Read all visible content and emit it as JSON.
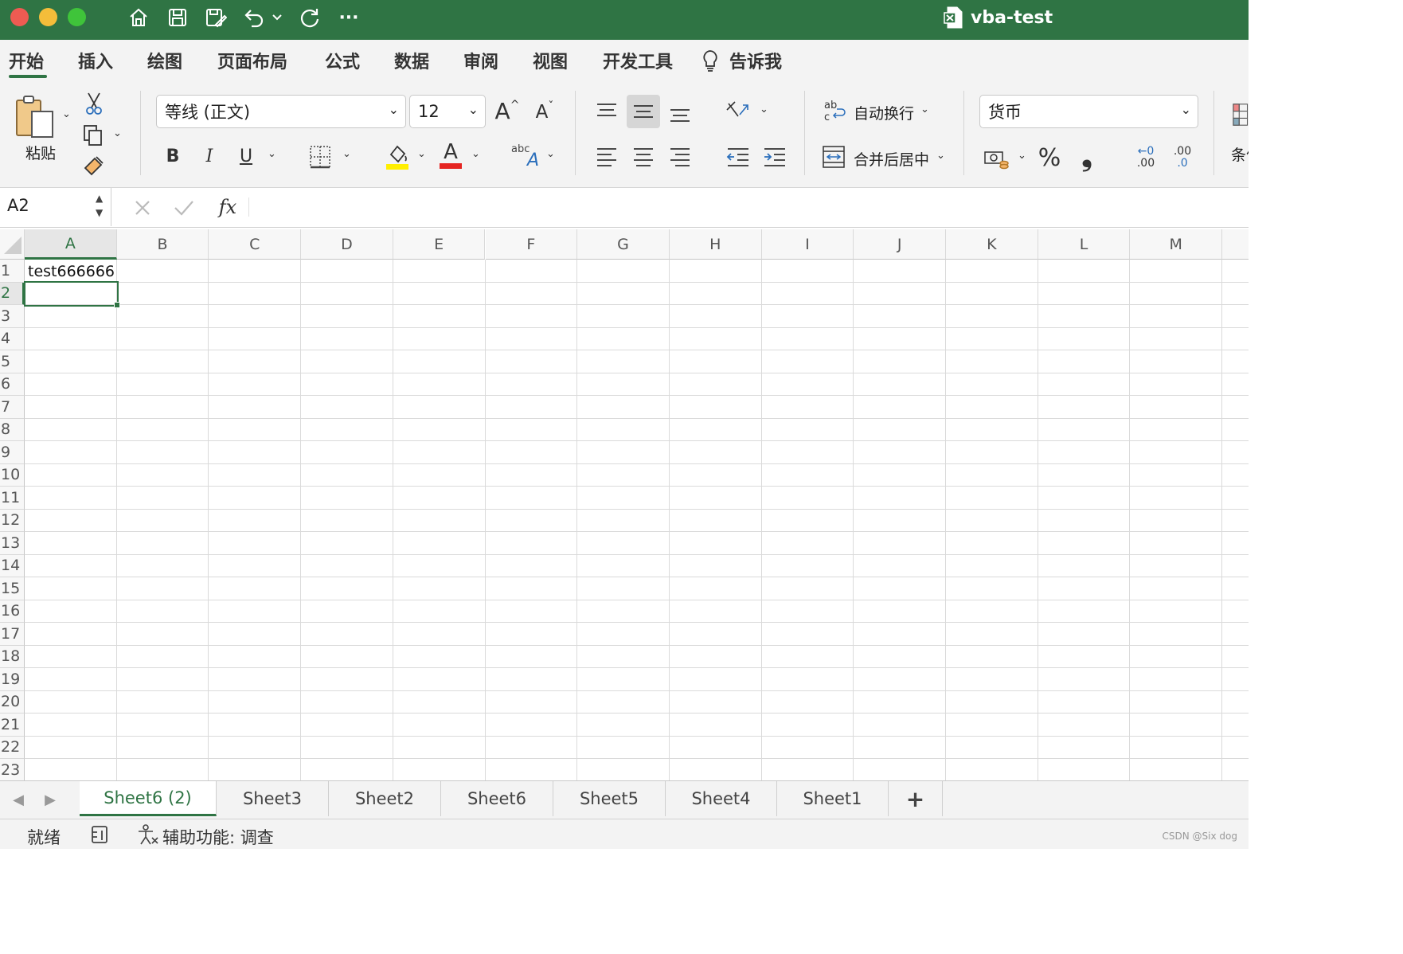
{
  "window": {
    "title": "vba-test",
    "title_icon": "excel-file-icon",
    "traffic_lights": {
      "close": "#ee5b52",
      "minimize": "#f4bd3a",
      "maximize": "#3fc43a"
    },
    "quick_access": [
      "home-icon",
      "save-icon",
      "save-as-icon",
      "undo-icon",
      "chevron-down-icon",
      "redo-icon",
      "more-icon"
    ],
    "more_label": "···",
    "accent_color": "#2f7444"
  },
  "menu": {
    "tabs": [
      "开始",
      "插入",
      "绘图",
      "页面布局",
      "公式",
      "数据",
      "审阅",
      "视图",
      "开发工具"
    ],
    "active": "开始",
    "tell_me": "告诉我"
  },
  "ribbon": {
    "paste_label": "粘贴",
    "font_name": "等线 (正文)",
    "font_size": "12",
    "bold": "B",
    "italic": "I",
    "underline": "U",
    "font_color_label": "A",
    "grow_font": "A",
    "shrink_font": "A",
    "abc_label": "abc",
    "wrap_text": "自动换行",
    "merge_center": "合并后居中",
    "number_format": "货币",
    "percent": "%",
    "comma": "❟",
    "increase_decimal": ".00",
    "decrease_decimal": ".0",
    "cond_format_partial": "条件",
    "fill_color": "#ffef00",
    "font_color": "#e52421"
  },
  "formula": {
    "name_box": "A2",
    "fx_label": "fx",
    "content": ""
  },
  "sheet": {
    "columns": [
      "A",
      "B",
      "C",
      "D",
      "E",
      "F",
      "G",
      "H",
      "I",
      "J",
      "K",
      "L",
      "M"
    ],
    "rows": [
      "1",
      "2",
      "3",
      "4",
      "5",
      "6",
      "7",
      "8",
      "9",
      "10",
      "11",
      "12",
      "13",
      "14",
      "15",
      "16",
      "17",
      "18",
      "19",
      "20",
      "21",
      "22",
      "23"
    ],
    "selected_cell": "A2",
    "cells": {
      "A1": "test666666"
    }
  },
  "tabs": {
    "sheets": [
      "Sheet6 (2)",
      "Sheet3",
      "Sheet2",
      "Sheet6",
      "Sheet5",
      "Sheet4",
      "Sheet1"
    ],
    "active": "Sheet6 (2)",
    "add_label": "+"
  },
  "status": {
    "ready": "就绪",
    "accessibility": "辅助功能: 调查",
    "watermark": "CSDN @Six dog"
  }
}
